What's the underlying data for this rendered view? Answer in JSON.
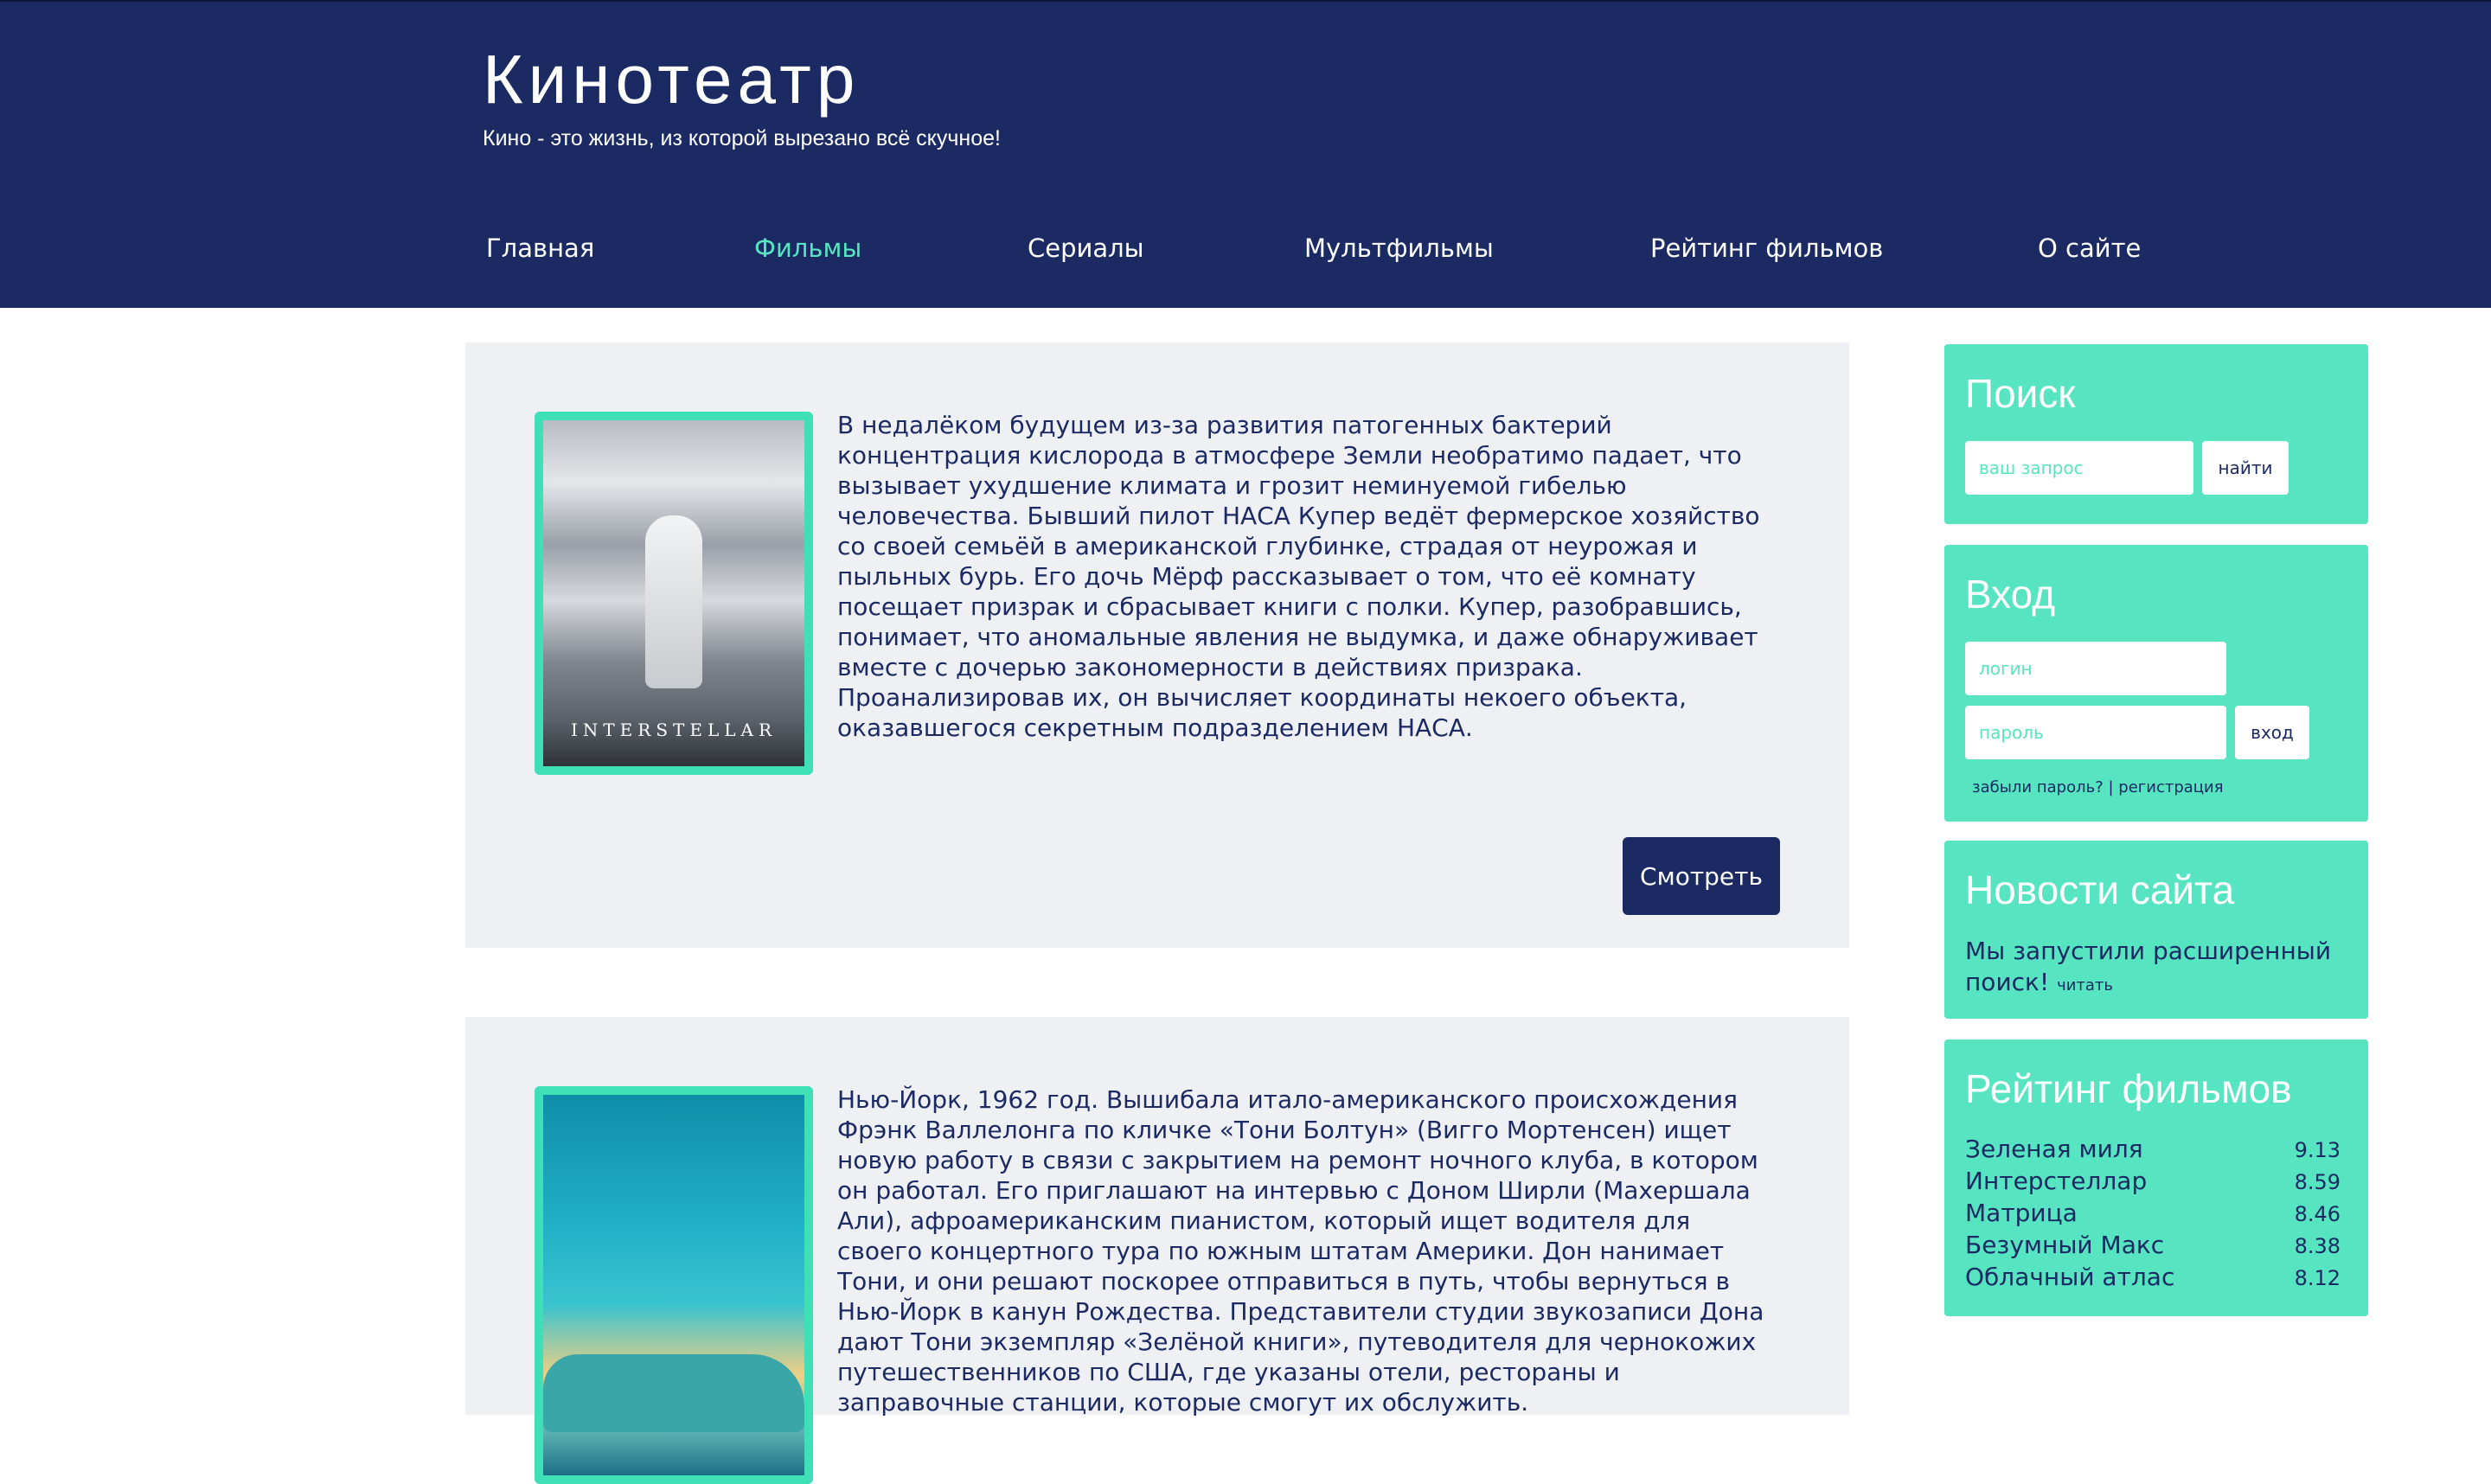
{
  "site": {
    "title": "Кинотеатр",
    "tagline": "Кино - это жизнь, из которой вырезано всё скучное!"
  },
  "nav": {
    "items": [
      {
        "label": "Главная",
        "active": false
      },
      {
        "label": "Фильмы",
        "active": true
      },
      {
        "label": "Сериалы",
        "active": false
      },
      {
        "label": "Мультфильмы",
        "active": false
      },
      {
        "label": "Рейтинг фильмов",
        "active": false
      },
      {
        "label": "О сайте",
        "active": false
      }
    ]
  },
  "movies": [
    {
      "poster_caption": "INTERSTELLAR",
      "description": "В недалёком будущем из-за развития патогенных бактерий концентрация кислорода в атмосфере Земли необратимо падает, что вызывает ухудшение климата и грозит неминуемой гибелью человечества. Бывший пилот НАСА Купер ведёт фермерское хозяйство со своей семьёй в американской глубинке, страдая от неурожая и пыльных бурь. Его дочь Мёрф рассказывает о том, что её комнату посещает призрак и сбрасывает книги с полки. Купер, разобравшись, понимает, что аномальные явления не выдумка, и даже обнаруживает вместе с дочерью закономерности в действиях призрака. Проанализировав их, он вычисляет координаты некоего объекта, оказавшегося секретным подразделением НАСА.",
      "button_label": "Смотреть"
    },
    {
      "description": "Нью-Йорк, 1962 год. Вышибала итало-американского происхождения Фрэнк Валлелонга по кличке «Тони Болтун» (Вигго Мортенсен) ищет новую работу в связи с закрытием на ремонт ночного клуба, в котором он работал. Его приглашают на интервью с Доном Ширли (Махершала Али), афроамериканским пианистом, который ищет водителя для своего концертного тура по южным штатам Америки. Дон нанимает Тони, и они решают поскорее отправиться в путь, чтобы вернуться в Нью-Йорк в канун Рождества. Представители студии звукозаписи Дона дают Тони экземпляр «Зелёной книги», путеводителя для чернокожих путешественников по США, где указаны отели, рестораны и заправочные станции, которые смогут их обслужить."
    }
  ],
  "sidebar": {
    "search": {
      "title": "Поиск",
      "placeholder": "ваш запрос",
      "button_label": "найти"
    },
    "login": {
      "title": "Вход",
      "login_placeholder": "логин",
      "password_placeholder": "пароль",
      "button_label": "вход",
      "forgot_label": "забыли пароль?",
      "separator": "|",
      "register_label": "регистрация"
    },
    "news": {
      "title": "Новости сайта",
      "text": "Мы запустили расширенный поиск!",
      "read_label": "читать"
    },
    "rating": {
      "title": "Рейтинг фильмов",
      "items": [
        {
          "name": "Зеленая миля",
          "score": "9.13"
        },
        {
          "name": "Интерстеллар",
          "score": "8.59"
        },
        {
          "name": "Матрица",
          "score": "8.46"
        },
        {
          "name": "Безумный Макс",
          "score": "8.38"
        },
        {
          "name": "Облачный атлас",
          "score": "8.12"
        }
      ]
    }
  },
  "colors": {
    "primary": "#1b2a63",
    "accent": "#56e4c1",
    "poster_border": "#3fe0b5",
    "card_bg": "#eff0f4"
  }
}
